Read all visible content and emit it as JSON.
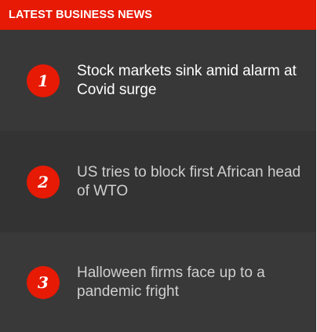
{
  "header": {
    "title": "LATEST BUSINESS NEWS"
  },
  "items": [
    {
      "rank": "1",
      "headline": "Stock markets sink amid alarm at Covid surge"
    },
    {
      "rank": "2",
      "headline": "US tries to block first African head of WTO"
    },
    {
      "rank": "3",
      "headline": "Halloween firms face up to a pandemic fright"
    }
  ],
  "colors": {
    "accent": "#e61a05",
    "background": "#343434",
    "headline_primary": "#ffffff",
    "headline_muted": "#cfcfcf"
  }
}
